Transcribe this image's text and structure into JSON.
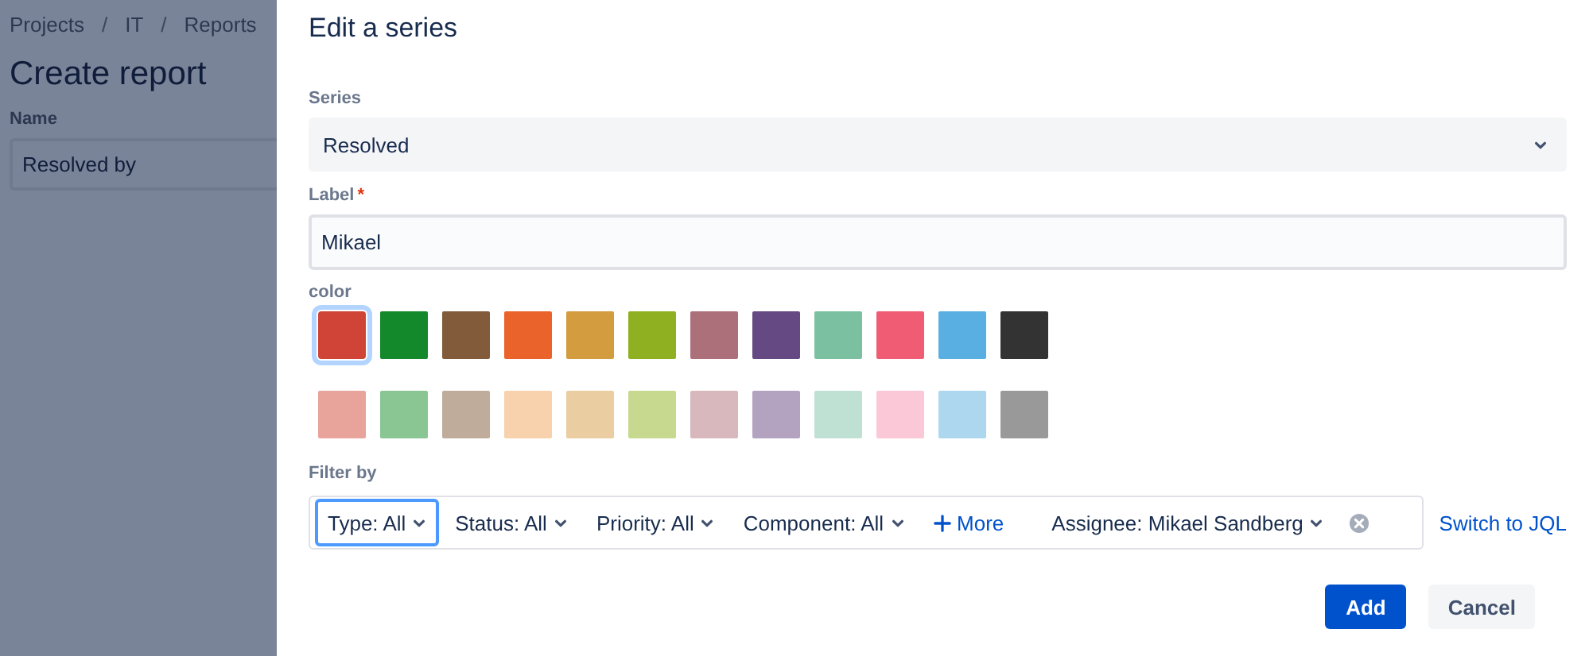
{
  "background_page": {
    "breadcrumbs": [
      {
        "kind": "link",
        "text": "Projects"
      },
      {
        "kind": "separator",
        "text": "/"
      },
      {
        "kind": "link",
        "text": "IT"
      },
      {
        "kind": "separator",
        "text": "/"
      },
      {
        "kind": "link",
        "text": "Reports"
      }
    ],
    "title": "Create report",
    "name_label": "Name",
    "name_value": "Resolved by"
  },
  "panel": {
    "title": "Edit a series",
    "series": {
      "label": "Series",
      "value": "Resolved"
    },
    "label_field": {
      "label": "Label",
      "required_mark": "*",
      "value": "Mikael"
    },
    "color": {
      "label": "color",
      "swatches": [
        {
          "color": "#d04437",
          "selected": true
        },
        {
          "color": "#14892c",
          "selected": false
        },
        {
          "color": "#815b3a",
          "selected": false
        },
        {
          "color": "#ea632b",
          "selected": false
        },
        {
          "color": "#d39c3f",
          "selected": false
        },
        {
          "color": "#8eb021",
          "selected": false
        },
        {
          "color": "#ac707a",
          "selected": false
        },
        {
          "color": "#654982",
          "selected": false
        },
        {
          "color": "#7bc1a1",
          "selected": false
        },
        {
          "color": "#f15c75",
          "selected": false
        },
        {
          "color": "#59afe1",
          "selected": false
        },
        {
          "color": "#333333",
          "selected": false
        },
        {
          "color": "#e8a39b",
          "selected": false
        },
        {
          "color": "#8ac594",
          "selected": false
        },
        {
          "color": "#c0ac9b",
          "selected": false
        },
        {
          "color": "#f8d1ad",
          "selected": false
        },
        {
          "color": "#eacda0",
          "selected": false
        },
        {
          "color": "#c7d98f",
          "selected": false
        },
        {
          "color": "#d8b8bd",
          "selected": false
        },
        {
          "color": "#b3a3c1",
          "selected": false
        },
        {
          "color": "#bfe1d3",
          "selected": false
        },
        {
          "color": "#fac8d6",
          "selected": false
        },
        {
          "color": "#add6ef",
          "selected": false
        },
        {
          "color": "#999999",
          "selected": false
        }
      ]
    },
    "filter": {
      "label": "Filter by",
      "items": [
        {
          "kind": "dropdown",
          "label": "Type: All",
          "selected": true
        },
        {
          "kind": "dropdown",
          "label": "Status: All",
          "selected": false
        },
        {
          "kind": "dropdown",
          "label": "Priority: All",
          "selected": false
        },
        {
          "kind": "dropdown",
          "label": "Component: All",
          "selected": false
        },
        {
          "kind": "add",
          "label": "More",
          "selected": false
        },
        {
          "kind": "clearable",
          "label": "Assignee: Mikael Sandberg",
          "selected": false
        }
      ],
      "switch_link": "Switch to JQL"
    },
    "buttons": [
      {
        "kind": "primary",
        "label": "Add"
      },
      {
        "kind": "subtle",
        "label": "Cancel"
      }
    ]
  }
}
